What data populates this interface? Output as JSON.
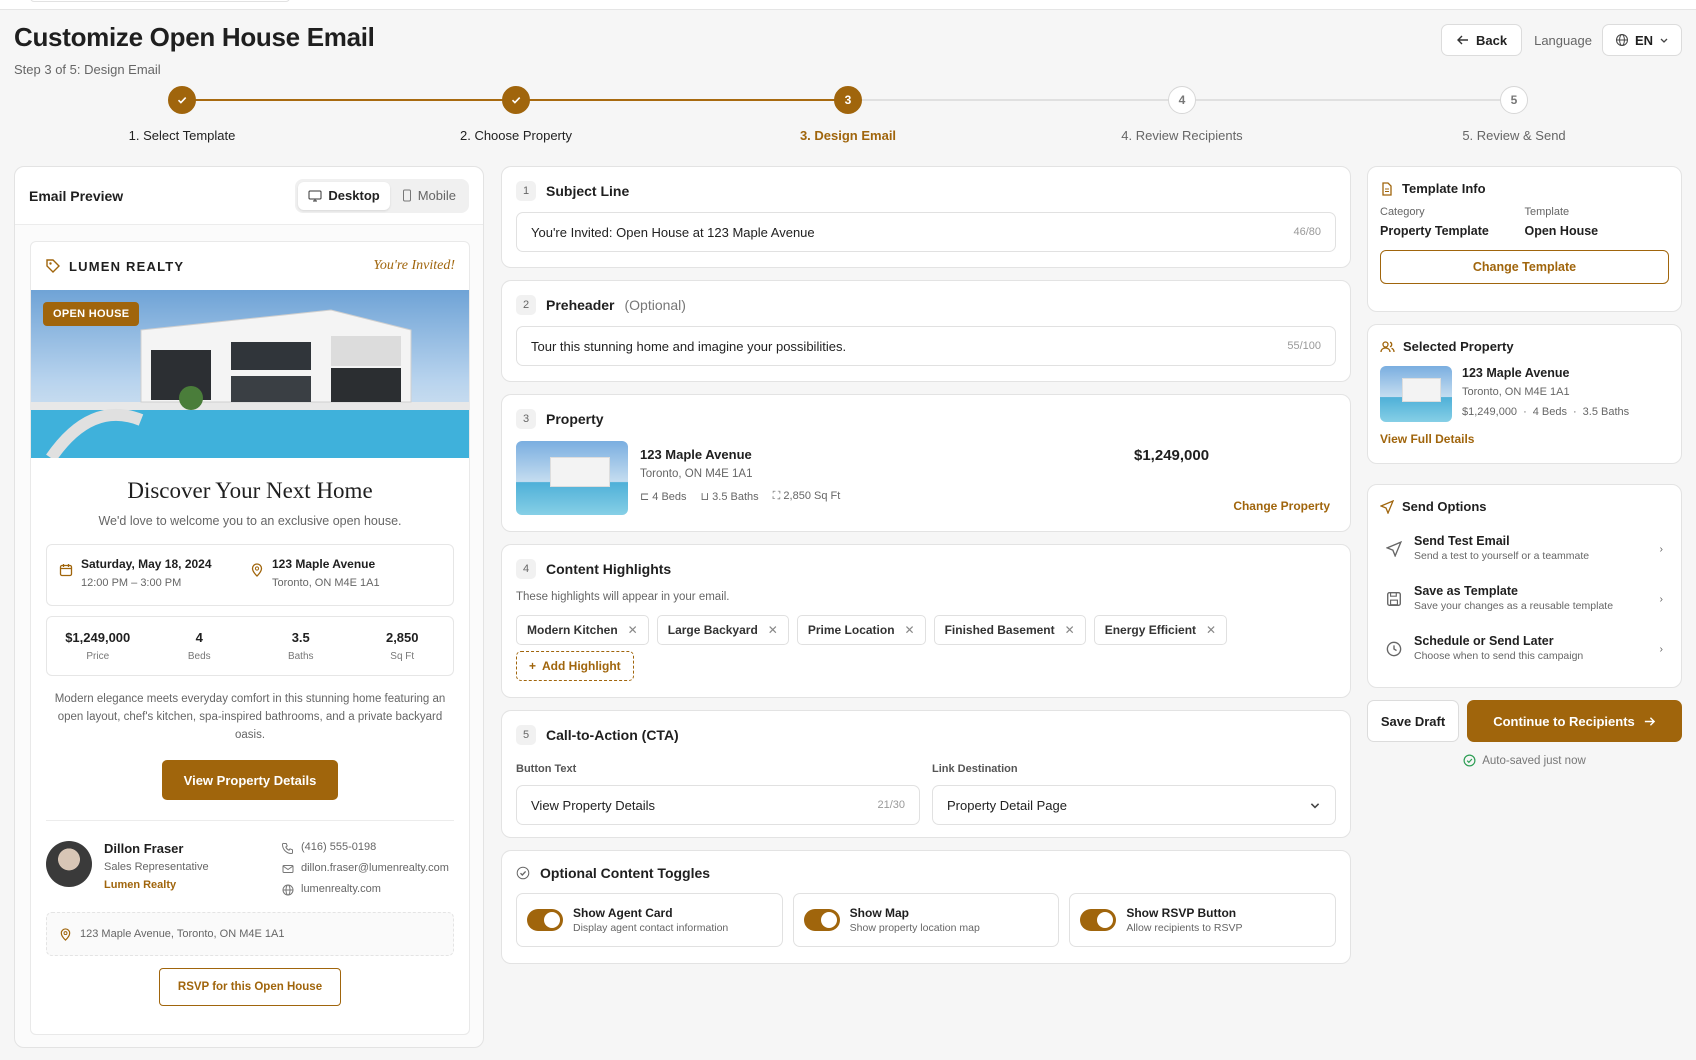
{
  "header": {
    "title": "Customize Open House Email",
    "step_text": "Step 3 of 5: Design Email",
    "back_label": "Back",
    "language_label": "Language",
    "language_value": "EN"
  },
  "stepper": {
    "steps": [
      {
        "number": "1",
        "label": "1. Select Template",
        "status": "done"
      },
      {
        "number": "2",
        "label": "2. Choose Property",
        "status": "done"
      },
      {
        "number": "3",
        "label": "3. Design Email",
        "status": "current"
      },
      {
        "number": "4",
        "label": "4. Review Recipients",
        "status": "todo"
      },
      {
        "number": "5",
        "label": "5. Review & Send",
        "status": "todo"
      }
    ]
  },
  "preview": {
    "title": "Email Preview",
    "desktop_label": "Desktop",
    "mobile_label": "Mobile",
    "brand": "LUMEN REALTY",
    "tagline": "You're Invited!",
    "badge": "OPEN HOUSE",
    "headline": "Discover Your Next Home",
    "subhead": "We'd love to welcome you to an exclusive open house.",
    "date": "Saturday, May 18, 2024",
    "time": "12:00 PM – 3:00 PM",
    "address_line1": "123 Maple Avenue",
    "address_line2": "Toronto, ON M4E 1A1",
    "stats": [
      {
        "value": "$1,249,000",
        "label": "Price"
      },
      {
        "value": "4",
        "label": "Beds"
      },
      {
        "value": "3.5",
        "label": "Baths"
      },
      {
        "value": "2,850",
        "label": "Sq Ft"
      }
    ],
    "description": "Modern elegance meets everyday comfort in this stunning home featuring an open layout, chef's kitchen, spa-inspired bathrooms, and a private backyard oasis.",
    "cta_label": "View Property Details",
    "agent_name": "Dillon Fraser",
    "agent_role": "Sales Representative",
    "agent_company": "Lumen Realty",
    "agent_phone": "(416) 555-0198",
    "agent_email": "dillon.fraser@lumenrealty.com",
    "agent_web": "lumenrealty.com",
    "full_address": "123 Maple Avenue, Toronto, ON M4E 1A1",
    "rsvp_label": "RSVP for this Open House"
  },
  "subject": {
    "num": "1",
    "title": "Subject Line",
    "value": "You're Invited: Open House at 123 Maple Avenue",
    "count": "46/80"
  },
  "preheader": {
    "num": "2",
    "title": "Preheader",
    "optional": "(Optional)",
    "value": "Tour this stunning home and imagine your possibilities.",
    "count": "55/100"
  },
  "property": {
    "num": "3",
    "title": "Property",
    "name": "123 Maple Avenue",
    "city": "Toronto, ON M4E 1A1",
    "beds": "4 Beds",
    "baths": "3.5 Baths",
    "sqft": "2,850 Sq Ft",
    "price": "$1,249,000",
    "change_label": "Change Property"
  },
  "highlights": {
    "num": "4",
    "title": "Content Highlights",
    "note": "These highlights will appear in your email.",
    "chips": [
      "Modern Kitchen",
      "Large Backyard",
      "Prime Location",
      "Finished Basement",
      "Energy Efficient"
    ],
    "add_label": "Add Highlight"
  },
  "cta": {
    "num": "5",
    "title": "Call-to-Action (CTA)",
    "button_text_label": "Button Text",
    "button_text_value": "View Property Details",
    "button_text_count": "21/30",
    "link_label": "Link Destination",
    "link_value": "Property Detail Page"
  },
  "toggles": {
    "title": "Optional Content Toggles",
    "items": [
      {
        "title": "Show Agent Card",
        "desc": "Display agent contact information",
        "on": true
      },
      {
        "title": "Show Map",
        "desc": "Show property location map",
        "on": true
      },
      {
        "title": "Show RSVP Button",
        "desc": "Allow recipients to RSVP",
        "on": true
      }
    ]
  },
  "template_info": {
    "title": "Template Info",
    "category_label": "Category",
    "category_value": "Property Template",
    "template_label": "Template",
    "template_value": "Open House",
    "change_label": "Change Template"
  },
  "selected_property": {
    "title": "Selected Property",
    "name": "123 Maple Avenue",
    "city": "Toronto, ON M4E 1A1",
    "price": "$1,249,000",
    "beds": "4 Beds",
    "baths": "3.5 Baths",
    "link": "View Full Details"
  },
  "send_options": {
    "title": "Send Options",
    "items": [
      {
        "title": "Send Test Email",
        "desc": "Send a test to yourself or a teammate"
      },
      {
        "title": "Save as Template",
        "desc": "Save your changes as a reusable template"
      },
      {
        "title": "Schedule or Send Later",
        "desc": "Choose when to send this campaign"
      }
    ]
  },
  "footer": {
    "save_draft": "Save Draft",
    "continue": "Continue to Recipients",
    "autosave": "Auto-saved just now"
  },
  "colors": {
    "accent": "#a0650c"
  }
}
